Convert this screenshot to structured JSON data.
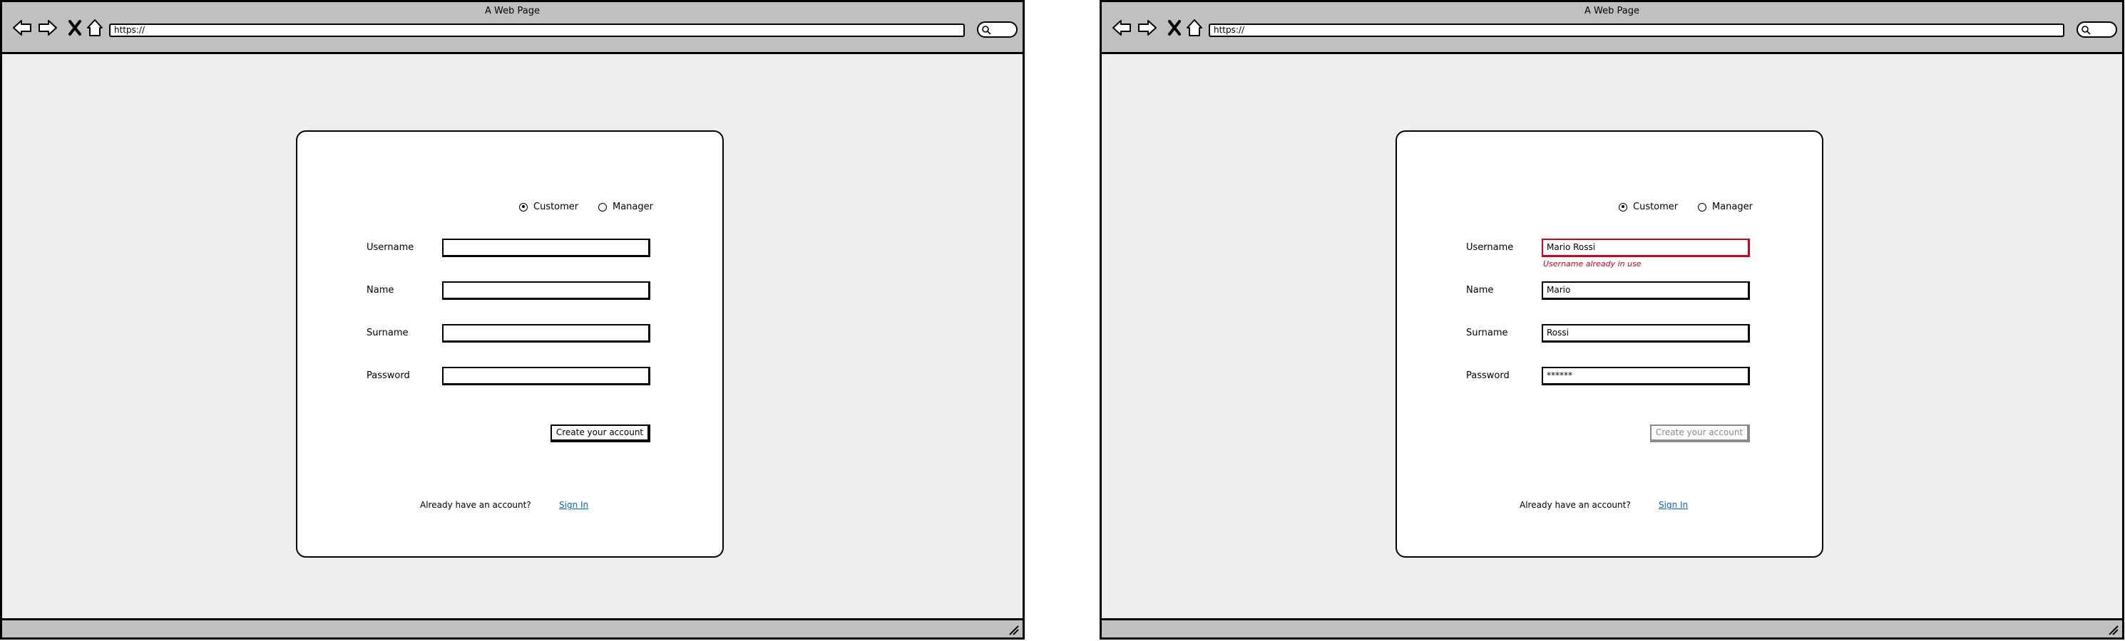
{
  "windows": {
    "left": {
      "title": "A Web Page",
      "address": "https://",
      "form": {
        "role_customer": "Customer",
        "role_manager": "Manager",
        "username_label": "Username",
        "name_label": "Name",
        "surname_label": "Surname",
        "password_label": "Password",
        "username_value": "",
        "name_value": "",
        "surname_value": "",
        "password_value": "",
        "create_button": "Create your account",
        "already_text": "Already have an account?",
        "signin_link": "Sign In"
      }
    },
    "right": {
      "title": "A Web Page",
      "address": "https://",
      "form": {
        "role_customer": "Customer",
        "role_manager": "Manager",
        "username_label": "Username",
        "name_label": "Name",
        "surname_label": "Surname",
        "password_label": "Password",
        "username_value": "Mario Rossi",
        "username_error": "Username already in use",
        "name_value": "Mario",
        "surname_value": "Rossi",
        "password_value": "******",
        "create_button": "Create your account",
        "already_text": "Already have an account?",
        "signin_link": "Sign In"
      }
    }
  },
  "colors": {
    "error": "#d0021b",
    "link": "#0067c2",
    "disabled": "#8a8a8a"
  },
  "icons": [
    "back-arrow-icon",
    "forward-arrow-icon",
    "stop-x-icon",
    "home-icon",
    "search-icon",
    "resize-grip-icon"
  ]
}
